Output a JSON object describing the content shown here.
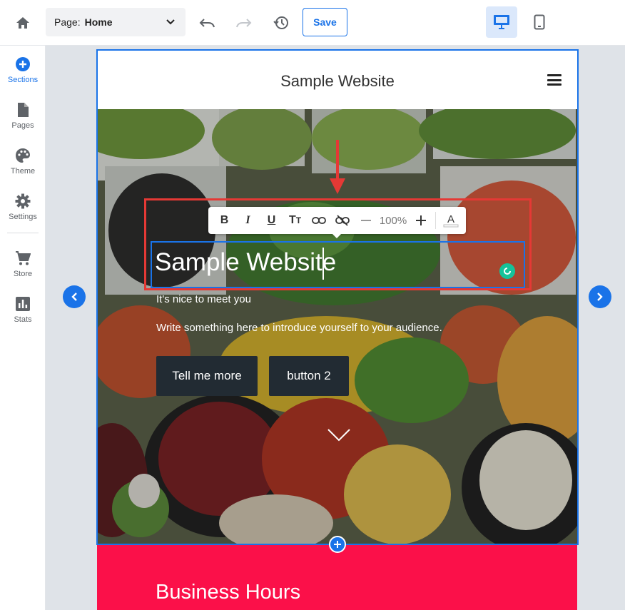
{
  "toolbar": {
    "page_label": "Page:",
    "page_value": "Home",
    "save_label": "Save",
    "icons": [
      "home-icon",
      "chevron-down-icon",
      "undo-icon",
      "redo-icon",
      "history-icon",
      "desktop-icon",
      "mobile-icon"
    ]
  },
  "sidebar": {
    "items": [
      {
        "label": "Sections",
        "icon": "plus-circle-icon",
        "active": true
      },
      {
        "label": "Pages",
        "icon": "page-icon"
      },
      {
        "label": "Theme",
        "icon": "palette-icon"
      },
      {
        "label": "Settings",
        "icon": "gear-icon"
      },
      {
        "label": "Store",
        "icon": "cart-icon"
      },
      {
        "label": "Stats",
        "icon": "bar-chart-icon"
      }
    ]
  },
  "site": {
    "header_title": "Sample Website",
    "hero": {
      "title": "Sample Website",
      "subtitle": "It's nice to meet you",
      "intro": "Write something here to introduce yourself to your audience.",
      "button1": "Tell me more",
      "button2": "button 2"
    },
    "next_section_title": "Business Hours"
  },
  "format_toolbar": {
    "zoom": "100%",
    "buttons": [
      "bold-icon",
      "italic-icon",
      "underline-icon",
      "text-size-icon",
      "link-icon",
      "unlink-icon",
      "minus-icon",
      "plus-icon",
      "font-color-icon"
    ]
  },
  "colors": {
    "accent": "#1a73e8",
    "highlight": "#e53935",
    "hours_bg": "#fb1049",
    "button_bg": "#222b33"
  }
}
